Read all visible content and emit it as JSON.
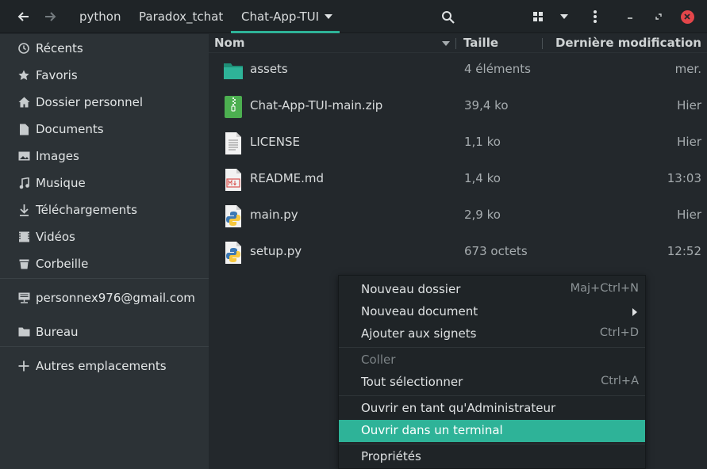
{
  "header": {
    "back_icon": "arrow-left-icon",
    "forward_icon": "arrow-right-icon",
    "breadcrumbs": [
      "python",
      "Paradox_tchat",
      "Chat-App-TUI"
    ],
    "search_icon": "search-icon",
    "view_icon": "grid-view-icon",
    "menu_icon": "kebab-menu-icon",
    "accent": "#2eb398",
    "close_color": "#e3464a"
  },
  "sidebar": {
    "items": [
      {
        "label": "Récents",
        "icon": "clock-icon"
      },
      {
        "label": "Favoris",
        "icon": "star-icon"
      },
      {
        "label": "Dossier personnel",
        "icon": "home-icon"
      },
      {
        "label": "Documents",
        "icon": "document-icon"
      },
      {
        "label": "Images",
        "icon": "image-icon"
      },
      {
        "label": "Musique",
        "icon": "music-icon"
      },
      {
        "label": "Téléchargements",
        "icon": "download-icon"
      },
      {
        "label": "Vidéos",
        "icon": "video-icon"
      },
      {
        "label": "Corbeille",
        "icon": "trash-icon"
      },
      {
        "label": "personnex976@gmail.com",
        "icon": "network-account-icon"
      },
      {
        "label": "Bureau",
        "icon": "folder-icon"
      },
      {
        "label": "Autres emplacements",
        "icon": "plus-icon"
      }
    ]
  },
  "columns": {
    "name": "Nom",
    "size": "Taille",
    "modified": "Dernière modification"
  },
  "files": [
    {
      "name": "assets",
      "size": "4 éléments",
      "date": "mer.",
      "icon": "folder-icon"
    },
    {
      "name": "Chat-App-TUI-main.zip",
      "size": "39,4 ko",
      "date": "Hier",
      "icon": "zip-archive-icon"
    },
    {
      "name": "LICENSE",
      "size": "1,1 ko",
      "date": "Hier",
      "icon": "text-file-icon"
    },
    {
      "name": "README.md",
      "size": "1,4 ko",
      "date": "13:03",
      "icon": "markdown-file-icon"
    },
    {
      "name": "main.py",
      "size": "2,9 ko",
      "date": "Hier",
      "icon": "python-file-icon"
    },
    {
      "name": "setup.py",
      "size": "673 octets",
      "date": "12:52",
      "icon": "python-file-icon"
    }
  ],
  "context_menu": {
    "items": [
      {
        "label": "Nouveau dossier",
        "shortcut": "Maj+Ctrl+N"
      },
      {
        "label": "Nouveau document",
        "shortcut": ""
      },
      {
        "label": "Ajouter aux signets",
        "shortcut": "Ctrl+D"
      },
      {
        "label": "Coller",
        "shortcut": ""
      },
      {
        "label": "Tout sélectionner",
        "shortcut": "Ctrl+A"
      },
      {
        "label": "Ouvrir en tant qu'Administrateur",
        "shortcut": ""
      },
      {
        "label": "Ouvrir dans un terminal",
        "shortcut": ""
      },
      {
        "label": "Propriétés",
        "shortcut": ""
      }
    ]
  }
}
